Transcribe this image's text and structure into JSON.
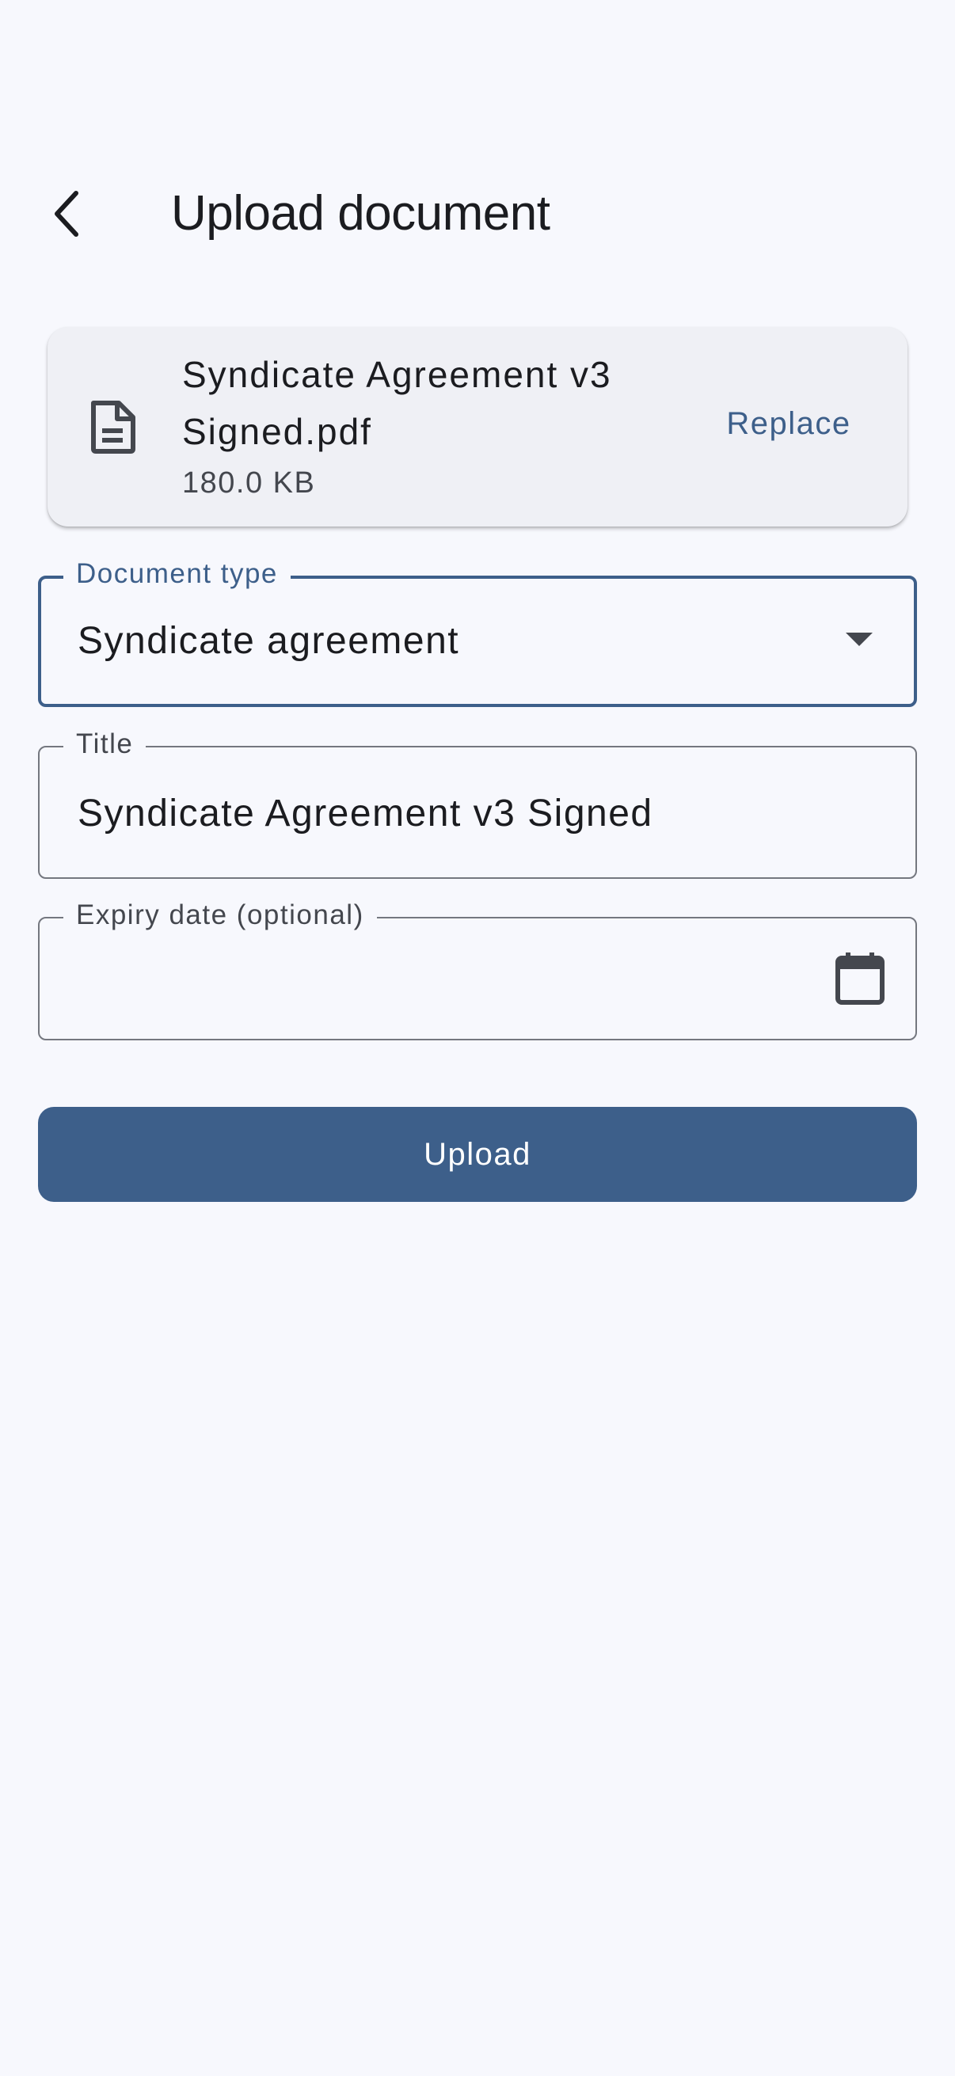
{
  "app_bar": {
    "title": "Upload document",
    "back_icon": "chevron-left-icon"
  },
  "file_card": {
    "icon": "document-icon",
    "file_name": "Syndicate Agreement v3 Signed.pdf",
    "file_size": "180.0 KB",
    "replace_label": "Replace"
  },
  "form": {
    "document_type": {
      "label": "Document type",
      "value": "Syndicate agreement",
      "icon": "dropdown-arrow-icon"
    },
    "title": {
      "label": "Title",
      "value": "Syndicate Agreement v3 Signed"
    },
    "expiry_date": {
      "label": "Expiry date (optional)",
      "value": "",
      "icon": "calendar-icon"
    }
  },
  "upload_label": "Upload",
  "colors": {
    "primary": "#3d5f8a",
    "background": "#f7f8fd",
    "card": "#eff0f5",
    "outline": "#74777f"
  }
}
